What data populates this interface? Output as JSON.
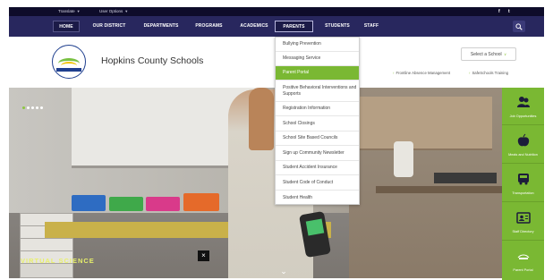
{
  "utility_bar": {
    "translate_label": "Translate",
    "user_options_label": "User Options",
    "social": [
      "f",
      "t"
    ]
  },
  "nav": {
    "items": [
      "HOME",
      "OUR DISTRICT",
      "DEPARTMENTS",
      "PROGRAMS",
      "ACADEMICS",
      "PARENTS",
      "STUDENTS",
      "STAFF"
    ],
    "active": "PARENTS"
  },
  "header": {
    "site_name": "Hopkins County Schools",
    "logo_text": "HOPKINS COUNTY",
    "select_school": "Select a School",
    "links": [
      "Frontline Absence Management",
      "SafeSchools Training"
    ]
  },
  "parents_menu": {
    "items": [
      "Bullying Prevention",
      "Messaging Service",
      "Parent Portal",
      "Positive Behavioral Interventions and Supports",
      "Registration Information",
      "School Closings",
      "School Site Based Councils",
      "Sign up Community Newsletter",
      "Student Accident Insurance",
      "Student Code of Conduct",
      "Student Health"
    ],
    "highlighted": "Parent Portal"
  },
  "hero": {
    "caption": "VIRTUAL SCIENCE",
    "close": "×",
    "scroll": "⌄"
  },
  "quick_links": [
    {
      "label": "Job Opportunities",
      "icon": "people-icon"
    },
    {
      "label": "Meals and Nutrition",
      "icon": "apple-icon"
    },
    {
      "label": "Transportation",
      "icon": "bus-icon"
    },
    {
      "label": "Staff Directory",
      "icon": "contact-card-icon"
    },
    {
      "label": "Parent Portal",
      "icon": "campus-logo-icon"
    }
  ],
  "colors": {
    "utility_bar": "#0e0c2a",
    "navbar": "#28275e",
    "accent_green": "#7ab833",
    "caption_yellow": "#e8f06a"
  }
}
